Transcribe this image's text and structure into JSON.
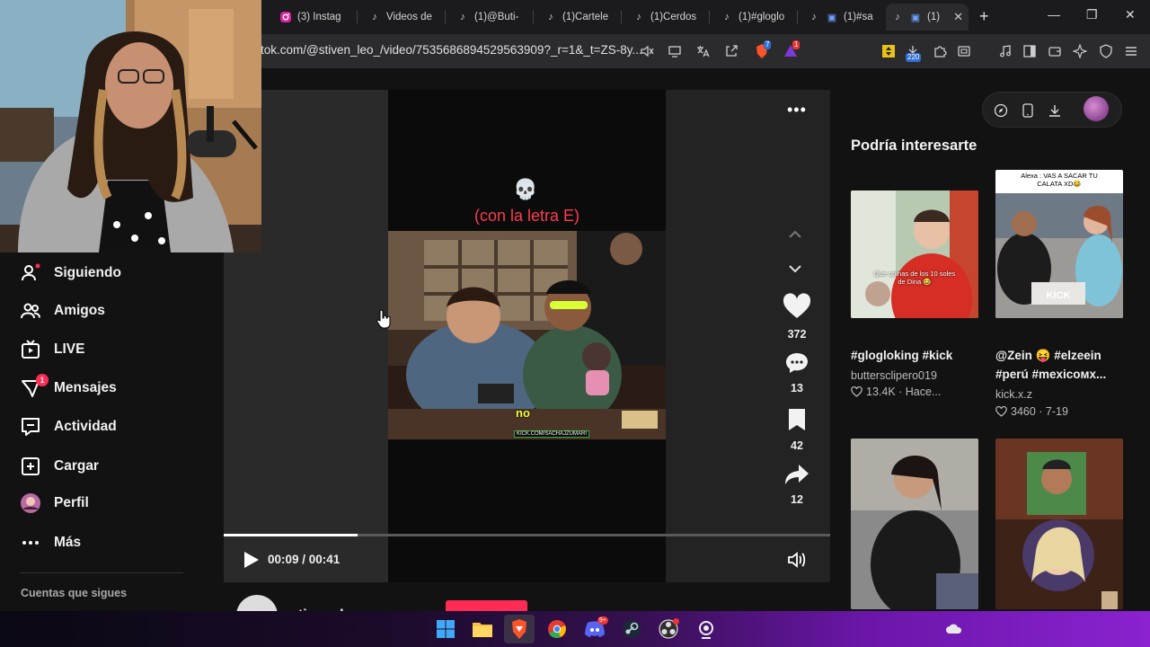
{
  "browser": {
    "tabs": [
      {
        "label": "(3) Instag",
        "icon": "instagram-icon"
      },
      {
        "label": "Videos de",
        "icon": "tiktok-icon"
      },
      {
        "label": "(1)@Buti-",
        "icon": "tiktok-icon"
      },
      {
        "label": "(1)Cartele",
        "icon": "tiktok-icon"
      },
      {
        "label": "(1)Cerdos",
        "icon": "tiktok-icon"
      },
      {
        "label": "(1)#gloglo",
        "icon": "tiktok-icon"
      },
      {
        "label": "(1)#sa",
        "icon": "tiktok-icon"
      },
      {
        "label": "(1)",
        "icon": "tiktok-icon"
      }
    ],
    "active_tab_index": 7,
    "url": "tok.com/@stiven_leo_/video/7535686894529563909?_r=1&_t=ZS-8y...",
    "brave_shield_count": "7",
    "rewards_count": "1",
    "extension_count": "220"
  },
  "sidebar": {
    "items": [
      {
        "label": "Siguiendo",
        "icon": "following-icon"
      },
      {
        "label": "Amigos",
        "icon": "friends-icon"
      },
      {
        "label": "LIVE",
        "icon": "live-icon"
      },
      {
        "label": "Mensajes",
        "icon": "messages-icon",
        "badge": "1"
      },
      {
        "label": "Actividad",
        "icon": "activity-icon"
      },
      {
        "label": "Cargar",
        "icon": "upload-icon"
      },
      {
        "label": "Perfil",
        "icon": "avatar"
      },
      {
        "label": "Más",
        "icon": "more-icon"
      }
    ],
    "footer": "Cuentas que sigues"
  },
  "video": {
    "emoji": "💀",
    "caption": "(con la letra E)",
    "subtitle": "no",
    "watermark": "KICK.COM/SACHAJZUMARI",
    "likes": "372",
    "comments": "13",
    "saves": "42",
    "shares": "12",
    "time": "00:09 / 00:41",
    "progress_fraction": 0.22,
    "author": "stiven_leo"
  },
  "recommendations": {
    "title": "Podría interesarte",
    "cards": [
      {
        "thumb_text": "Que opinas de los 10 soles de Dina 😂",
        "caption": "#glogloking #kick",
        "author": "buttersclipero019",
        "meta": "13.4K · Hace..."
      },
      {
        "thumb_text": "Alexa : VAS A SACAR TU CALATA XD😂",
        "caption": "@Zein 😝 #elzeein #perú #mexicoмх...",
        "author": "kick.x.z",
        "meta": "3460 · 7-19"
      },
      {
        "thumb_text": "",
        "caption": "",
        "author": "",
        "meta": ""
      },
      {
        "thumb_text": "",
        "caption": "",
        "author": "",
        "meta": ""
      }
    ]
  },
  "colors": {
    "accent": "#fe2c55",
    "caption_red": "#ff3b4e",
    "subtitle_yellow": "#f2ff3a"
  }
}
